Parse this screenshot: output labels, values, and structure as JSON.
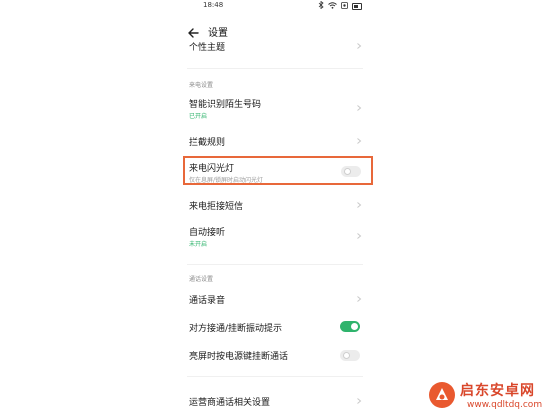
{
  "status_bar": {
    "time": "18:48",
    "icons": [
      "bluetooth-icon",
      "wifi-icon",
      "alarm-icon",
      "battery-icon"
    ]
  },
  "header": {
    "title": "设置"
  },
  "rows": {
    "theme": {
      "label": "个性主题"
    },
    "section_incoming": "来电设置",
    "smart_id": {
      "label": "智能识别陌生号码",
      "status": "已开启"
    },
    "block_rules": {
      "label": "拦截规则"
    },
    "flash": {
      "label": "来电闪光灯",
      "sub": "仅在息屏/锁屏时启动闪光灯",
      "enabled": false
    },
    "reject_sms": {
      "label": "来电拒接短信"
    },
    "auto_answer": {
      "label": "自动接听",
      "status": "未开启"
    },
    "section_call": "通话设置",
    "recording": {
      "label": "通话录音"
    },
    "vibrate": {
      "label": "对方接通/挂断振动提示",
      "enabled": true
    },
    "power_hangup": {
      "label": "亮屏时按电源键挂断通话",
      "enabled": false
    },
    "carrier": {
      "label": "运营商通话相关设置"
    }
  },
  "colors": {
    "accent_green": "#2fb36c",
    "highlight_border": "#e8683a",
    "watermark": "#d9472b"
  },
  "watermark": {
    "brand": "启东安卓网",
    "url": "www.qdltdq.com"
  }
}
